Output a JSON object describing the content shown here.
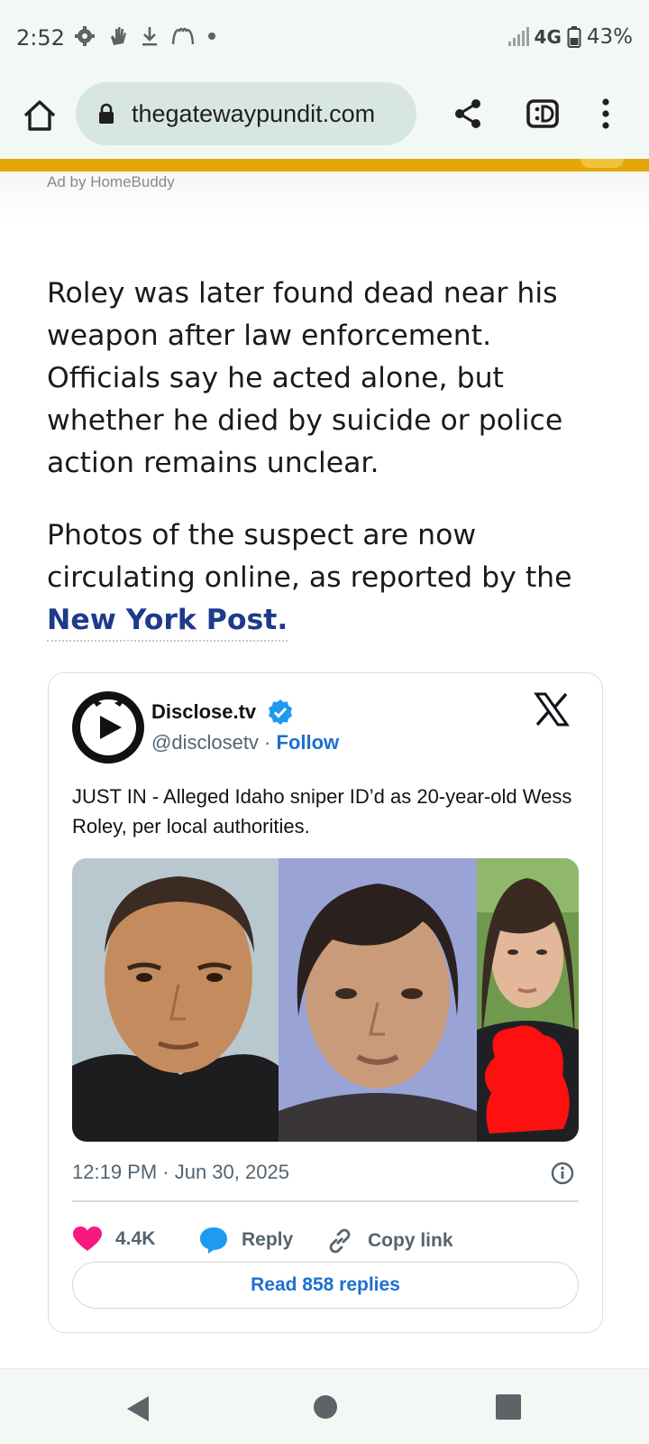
{
  "status_bar": {
    "time": "2:52",
    "network": "4G",
    "battery": "43%",
    "icons": [
      "gear-icon",
      "hand-icon",
      "download-icon",
      "mcdonalds-icon",
      "dot-icon",
      "signal-icon",
      "battery-icon"
    ]
  },
  "browser": {
    "url": "thegatewaypundit.com",
    "icons": [
      "home-icon",
      "lock-icon",
      "share-icon",
      "tab-switcher-icon",
      "more-vert-icon"
    ]
  },
  "ad": {
    "label": "Ad by HomeBuddy",
    "accent_color": "#e3a808"
  },
  "article": {
    "paragraph1": "Roley was later found dead near his weapon after law enforcement. Officials say he acted alone, but whether he died by suicide or police action remains unclear.",
    "paragraph2_text": "Photos of the suspect are now circulating online, as reported by the ",
    "paragraph2_link": "New York Post.",
    "link_color": "#1e3a8a"
  },
  "tweet": {
    "author_name": "Disclose.tv",
    "handle": "@disclosetv",
    "separator": " · ",
    "follow_label": "Follow",
    "text": "JUST IN - Alleged Idaho sniper ID’d as 20-year-old Wess Roley, per local authorities.",
    "timestamp": "12:19 PM · Jun 30, 2025",
    "likes": "4.4K",
    "reply_label": "Reply",
    "copy_link_label": "Copy link",
    "read_replies_label": "Read 858 replies",
    "brand_color": "#1d6fd1",
    "like_color": "#f91880"
  }
}
